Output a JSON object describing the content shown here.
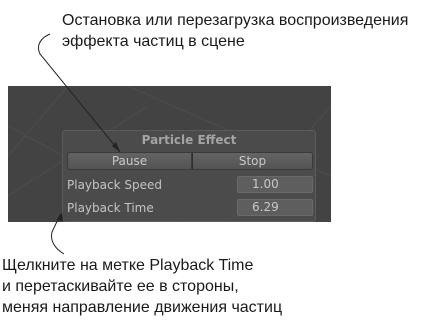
{
  "annotations": {
    "top": [
      "Остановка или перезагрузка воспроизведения",
      "эффекта частиц в сцене"
    ],
    "bottom": [
      "Щелкните на метке Playback Time",
      "и перетаскивайте ее в стороны,",
      "меняя направление движения частиц"
    ]
  },
  "panel": {
    "title": "Particle Effect",
    "pause_label": "Pause",
    "stop_label": "Stop",
    "rows": [
      {
        "label": "Playback Speed",
        "value": "1.00"
      },
      {
        "label": "Playback Time",
        "value": "6.29"
      }
    ]
  },
  "colors": {
    "scene_background": "#434343",
    "panel_background": "#4c4c4c",
    "text": "#c4c4c4"
  }
}
